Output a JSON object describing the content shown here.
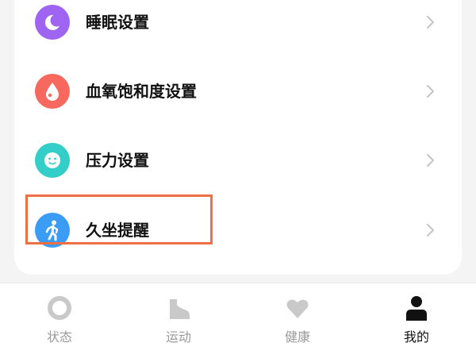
{
  "settings": {
    "items": [
      {
        "label": "睡眠设置",
        "icon": "moon-icon",
        "color": "#a064f2"
      },
      {
        "label": "血氧饱和度设置",
        "icon": "blood-drop-icon",
        "color": "#f7685e"
      },
      {
        "label": "压力设置",
        "icon": "smiley-face-icon",
        "color": "#32cec7"
      },
      {
        "label": "久坐提醒",
        "icon": "sedentary-person-icon",
        "color": "#3b9cf5"
      }
    ],
    "highlight_color": "#ee6f44"
  },
  "tabbar": {
    "tabs": [
      {
        "label": "状态",
        "icon": "ring-icon",
        "active": false
      },
      {
        "label": "运动",
        "icon": "shoe-icon",
        "active": false
      },
      {
        "label": "健康",
        "icon": "heart-icon",
        "active": false
      },
      {
        "label": "我的",
        "icon": "person-icon",
        "active": true
      }
    ],
    "active_color": "#111111",
    "inactive_color": "#9a9a9a"
  }
}
